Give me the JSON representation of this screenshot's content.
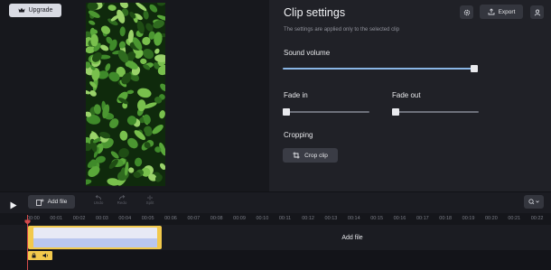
{
  "header": {
    "upgrade_label": "Upgrade"
  },
  "panel": {
    "title": "Clip settings",
    "subtitle": "The settings are applied only to the selected clip",
    "export_label": "Export",
    "sound_volume": {
      "label": "Sound volume",
      "value": 1.0
    },
    "fade_in": {
      "label": "Fade in",
      "value": 0.0
    },
    "fade_out": {
      "label": "Fade out",
      "value": 0.0
    },
    "cropping": {
      "label": "Cropping",
      "button_label": "Crop clip"
    }
  },
  "timeline": {
    "add_file_label": "Add file",
    "controls": {
      "undo": "Undo",
      "redo": "Redo",
      "split": "Split"
    },
    "ticks": [
      "00:00",
      "00:01",
      "00:02",
      "00:03",
      "00:04",
      "00:05",
      "00:06",
      "00:07",
      "00:08",
      "00:09",
      "00:10",
      "00:11",
      "00:12",
      "00:13",
      "00:14",
      "00:15",
      "00:16",
      "00:17",
      "00:18",
      "00:19",
      "00:20",
      "00:21",
      "00:22"
    ],
    "track_add_file_label": "Add file"
  },
  "colors": {
    "accent": "#8ab6e6",
    "clip_border": "#f2c94c",
    "playhead": "#d44b4b"
  }
}
